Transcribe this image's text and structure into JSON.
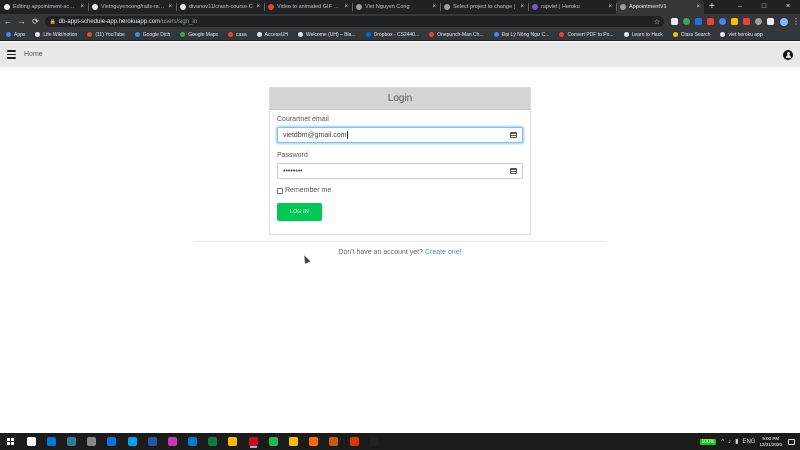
{
  "browser": {
    "tabs": [
      {
        "title": "Editing appointment-schedule",
        "favicon_color": "#e8eaed",
        "active": false
      },
      {
        "title": "Vietnguyencong/rails-rapvi",
        "favicon_color": "#e8eaed",
        "active": false
      },
      {
        "title": "divanov11/crash-course-C",
        "favicon_color": "#e8eaed",
        "active": false
      },
      {
        "title": "Video to animated GIF con",
        "favicon_color": "#ea4335",
        "active": false
      },
      {
        "title": "Viet Nguyen Cong",
        "favicon_color": "#9aa0a6",
        "active": false
      },
      {
        "title": "Select project to change |",
        "favicon_color": "#9aa0a6",
        "active": false
      },
      {
        "title": "rapviet | Heroku",
        "favicon_color": "#7e57c2",
        "active": false
      },
      {
        "title": "AppointmentV1",
        "favicon_color": "#9aa0a6",
        "active": true
      }
    ],
    "tab_close_glyph": "×",
    "new_tab_glyph": "+",
    "window_controls": [
      "–",
      "□",
      "×"
    ],
    "nav": {
      "back": "←",
      "forward": "→",
      "reload": "⟳"
    },
    "url_host": "db-appt-schedule-app.herokuapp.com",
    "url_path": "/users/sign_in",
    "extension_colors": [
      "#e8eaed",
      "#34a853",
      "#1a73e8",
      "#ea4335",
      "#4285f4",
      "#fbbc04",
      "#ea4335",
      "#9aa0a6",
      "#e8eaed"
    ],
    "bookmarks": [
      {
        "label": "Apps",
        "color": "#4285f4"
      },
      {
        "label": "Life Wiki/notion",
        "color": "#e8eaed"
      },
      {
        "label": "(11) YouTube",
        "color": "#ea4335"
      },
      {
        "label": "Google Dịch",
        "color": "#4285f4"
      },
      {
        "label": "Google Maps",
        "color": "#34a853"
      },
      {
        "label": "casa",
        "color": "#ea4335"
      },
      {
        "label": "AccessUH",
        "color": "#e8eaed"
      },
      {
        "label": "Welcome (UH) – Bla...",
        "color": "#e8eaed"
      },
      {
        "label": "Dropbox - CS2440...",
        "color": "#0061ff"
      },
      {
        "label": "Onepunch-Man Ch...",
        "color": "#ea4335"
      },
      {
        "label": "Đại Lý Nông Ngư C...",
        "color": "#4285f4"
      },
      {
        "label": "Convert PDF to Po...",
        "color": "#ea4335"
      },
      {
        "label": "Learn to Hack",
        "color": "#e8eaed"
      },
      {
        "label": "Class Search",
        "color": "#fbbc04"
      },
      {
        "label": "viet heroku app",
        "color": "#e8eaed"
      }
    ]
  },
  "navbar": {
    "home_label": "Home"
  },
  "login": {
    "heading": "Login",
    "email_label": "Courartnet email",
    "email_value": "vietdbm@gmail.com",
    "password_label": "Password",
    "password_value": "••••••••",
    "remember_label": "Remember me",
    "submit_label": "LOG IN"
  },
  "signup": {
    "prompt": "Don't have an account yet?",
    "link_text": "Create one!"
  },
  "colors": {
    "login_button": "#00c853",
    "link": "#4a90d9",
    "card_header": "#d4d4d4"
  },
  "taskbar": {
    "app_colors": [
      "#ffffff",
      "#0078d4",
      "#2d7d9a",
      "#888888",
      "#0b74da",
      "#00a2ed",
      "#2b579a",
      "#c239b3",
      "#007acc",
      "#107c41",
      "#ffb900",
      "#c50f1f",
      "#1db954",
      "#fbbc04",
      "#ff6a00",
      "#c75b12",
      "#d83b01",
      "#222222"
    ],
    "active_index": 11,
    "battery": "100%",
    "tray_icons": [
      "^",
      "♪",
      "▮"
    ],
    "language": "ENG",
    "time": "5:00 PM",
    "date": "12/31/2020"
  }
}
